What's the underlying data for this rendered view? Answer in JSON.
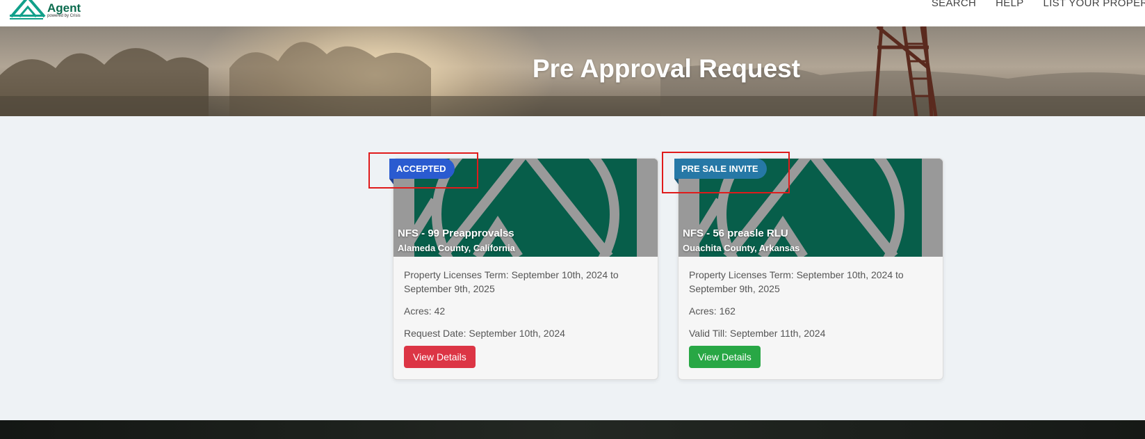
{
  "header": {
    "logo_text": "Outdoor\nAgent",
    "logo_sub": "powered by Crisis",
    "nav": [
      "SEARCH",
      "HELP",
      "LIST YOUR PROPERTY"
    ]
  },
  "hero": {
    "title": "Pre Approval Request"
  },
  "cards": [
    {
      "badge": "ACCEPTED",
      "title": "NFS - 99 Preapprovalss",
      "location": "Alameda County, California",
      "term": "Property Licenses Term: September 10th, 2024 to September 9th, 2025",
      "acres": "Acres: 42",
      "date": "Request Date: September 10th, 2024",
      "button": "View Details"
    },
    {
      "badge": "PRE SALE INVITE",
      "title": "NFS - 56 preasle RLU",
      "location": "Ouachita County, Arkansas",
      "term": "Property Licenses Term: September 10th, 2024 to September 9th, 2025",
      "acres": "Acres: 162",
      "date": "Valid Till: September 11th, 2024",
      "button": "View Details"
    }
  ],
  "colors": {
    "brand_green": "#0b6b4e",
    "accepted_badge": "#2a5bd0",
    "presale_badge": "#2678a6",
    "btn_red": "#dc3545",
    "btn_green": "#28a745",
    "highlight": "#e01b1b"
  }
}
